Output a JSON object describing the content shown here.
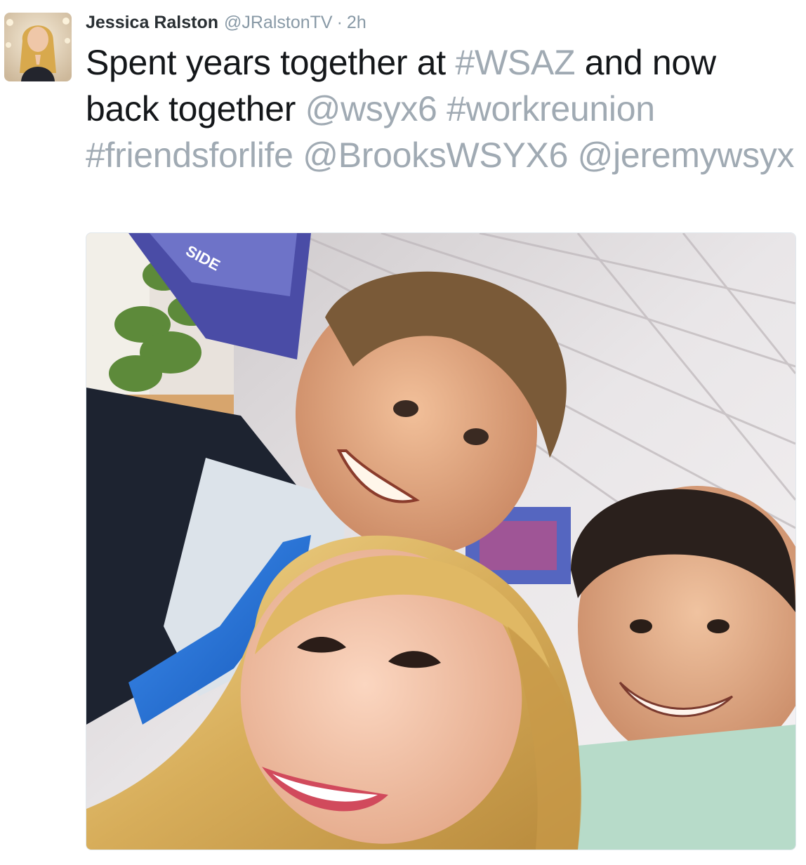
{
  "tweet": {
    "author_name": "Jessica Ralston",
    "author_handle": "@JRalstonTV",
    "separator": "·",
    "timestamp": "2h",
    "text": {
      "part1": "Spent years together at ",
      "hashtag_wsaz": "#WSAZ",
      "part2": " and now back together ",
      "mention_wsyx6": "@wsyx6",
      "space1": " ",
      "hashtag_workreunion": "#workreunion",
      "space2": " ",
      "hashtag_friendsforlife": "#friendsforlife",
      "space3": " ",
      "mention_brooks": "@BrooksWSYX6",
      "space4": " ",
      "mention_jeremy": "@jeremywsyx"
    },
    "media": {
      "sign_text": "SIDE"
    }
  },
  "colors": {
    "name": "#292f33",
    "meta": "#8899a6",
    "text": "#14171a",
    "link": "#a0aab3"
  }
}
